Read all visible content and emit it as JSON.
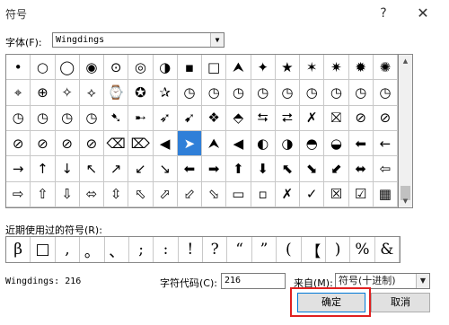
{
  "window": {
    "title": "符号",
    "help": "?",
    "close": "✕"
  },
  "font": {
    "label": "字体(F):",
    "value": "Wingdings",
    "arrow": "▼"
  },
  "symbols": [
    [
      "•",
      "○",
      "◯",
      "◉",
      "⊙",
      "◎",
      "◑",
      "▪",
      "□",
      "⮝",
      "✦",
      "★",
      "✶",
      "✷",
      "✹",
      "✺"
    ],
    [
      "⌖",
      "⊕",
      "✧",
      "⟡",
      "⌚",
      "✪",
      "✰",
      "◷",
      "◷",
      "◷",
      "◷",
      "◷",
      "◷",
      "◷",
      "◷",
      "◷"
    ],
    [
      "◷",
      "◷",
      "◷",
      "◷",
      "➷",
      "➸",
      "➶",
      "➹",
      "❖",
      "⬘",
      "⮀",
      "⮂",
      "✗",
      "⛝",
      "⊘",
      "⊘"
    ],
    [
      "⊘",
      "⊘",
      "⊘",
      "⊘",
      "⌫",
      "⌦",
      "◀",
      "➤",
      "⮝",
      "◀",
      "◐",
      "◑",
      "◓",
      "◒",
      "⬅",
      "←"
    ],
    [
      "→",
      "↑",
      "↓",
      "↖",
      "↗",
      "↙",
      "↘",
      "⬅",
      "➡",
      "⬆",
      "⬇",
      "⬉",
      "⬊",
      "⬋",
      "⬌",
      "⇦"
    ],
    [
      "⇨",
      "⇧",
      "⇩",
      "⬄",
      "⇳",
      "⬁",
      "⬀",
      "⬃",
      "⬂",
      "▭",
      "▫",
      "✗",
      "✓",
      "☒",
      "☑",
      "▦"
    ]
  ],
  "selected_index": 55,
  "recent": {
    "label": "近期使用过的符号(R):",
    "items": [
      "β",
      "□",
      ",",
      "。",
      "、",
      ";",
      ":",
      "!",
      "?",
      "“",
      "”",
      "(",
      "【",
      ")",
      "%",
      "&"
    ]
  },
  "status_text": "Wingdings: 216",
  "char_code": {
    "label": "字符代码(C):",
    "value": "216"
  },
  "from": {
    "label": "来自(M):",
    "value": "符号(十进制)",
    "arrow": "▼"
  },
  "buttons": {
    "ok": "确定",
    "cancel": "取消"
  }
}
